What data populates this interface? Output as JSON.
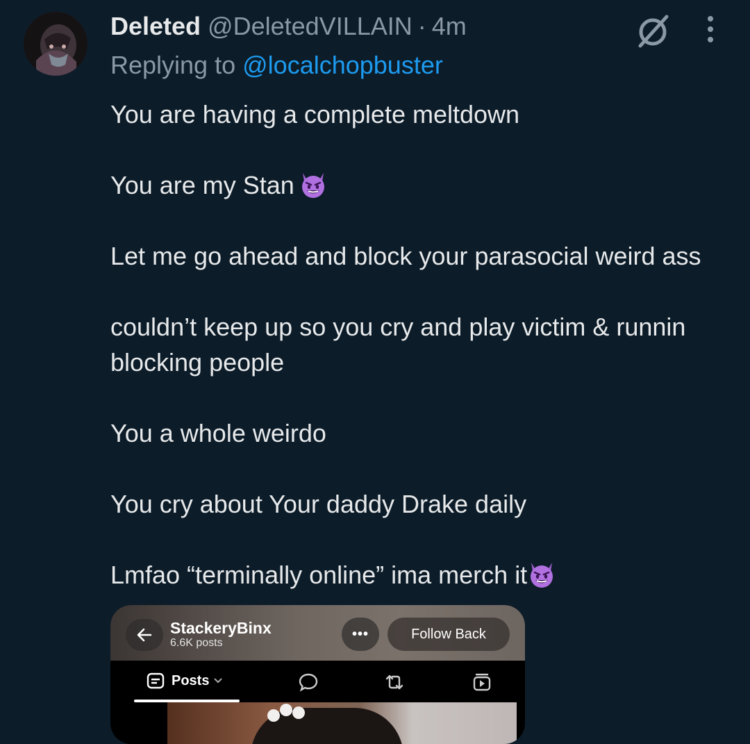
{
  "tweet": {
    "display_name": "Deleted",
    "handle": "@DeletedVILLAIN",
    "separator": "·",
    "time": "4m",
    "replying_prefix": "Replying to",
    "replying_to": "@localchopbuster",
    "paragraphs": [
      "You are having a complete meltdown",
      "You are my Stan",
      "Let me go ahead and block your parasocial weird ass",
      "couldn’t keep up so you cry and play victim & runnin blocking people",
      "You a whole weirdo",
      "You cry about Your daddy Drake daily",
      "Lmfao “terminally online” ima merch it"
    ],
    "emoji": "smiling-face-with-horns",
    "icons": {
      "avatar": "avatar-image",
      "grok": "grok-icon",
      "more": "more-vertical-icon"
    }
  },
  "embedded_screenshot": {
    "profile_name": "StackeryBinx",
    "post_count": "6.6K posts",
    "more_label": "•••",
    "follow_button": "Follow Back",
    "tabs": [
      {
        "label": "Posts",
        "icon": "posts-icon",
        "selected": true
      },
      {
        "label": "",
        "icon": "chat-bubble-icon"
      },
      {
        "label": "",
        "icon": "repost-icon"
      },
      {
        "label": "",
        "icon": "video-tab-icon"
      }
    ]
  },
  "colors": {
    "background": "#0c1c29",
    "text": "#e7e9ea",
    "muted": "#8b98a5",
    "link": "#1d9bf0"
  }
}
